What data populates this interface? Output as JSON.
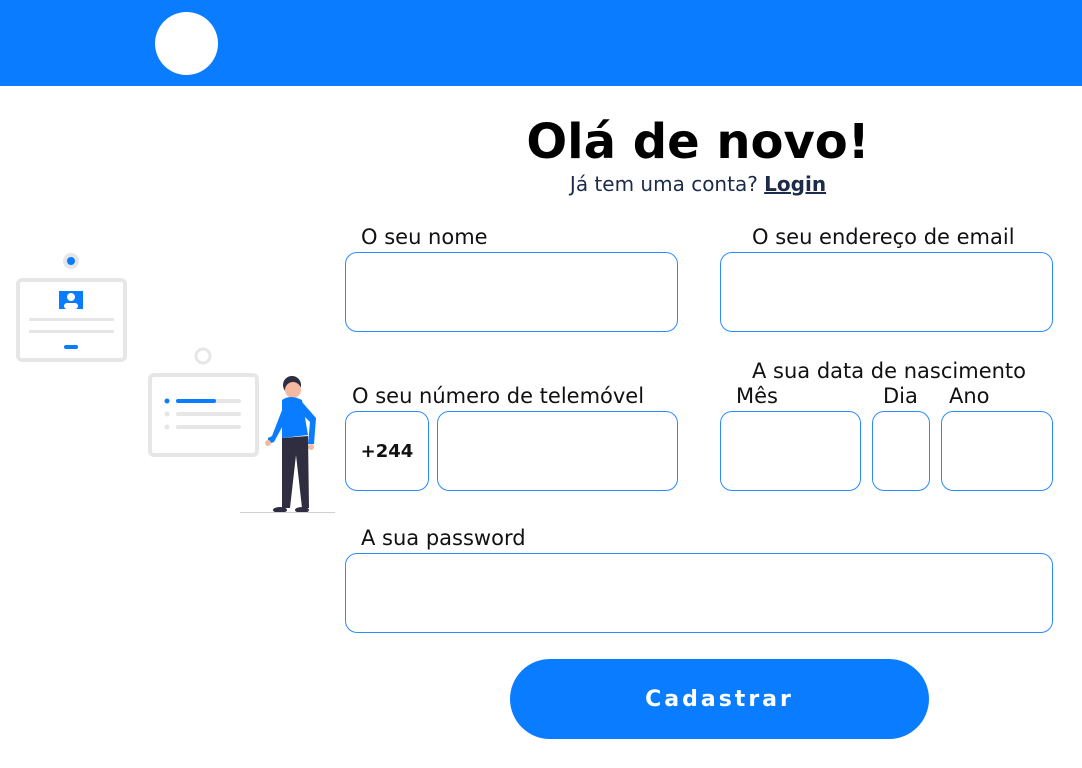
{
  "header": {
    "logo_alt": "logo"
  },
  "heading": {
    "title": "Olá de novo!",
    "subtitle": "Já tem uma conta?",
    "login_link": "Login"
  },
  "form": {
    "name_label": "O seu nome",
    "email_label": "O seu endereço de email",
    "phone_label": "O seu número de telemóvel",
    "phone_prefix": "+244",
    "birthdate_label": "A sua data de nascimento",
    "month_label": "Mês",
    "day_label": "Dia",
    "year_label": "Ano",
    "password_label": "A sua password",
    "submit_label": "Cadastrar"
  },
  "colors": {
    "primary": "#0a7cff",
    "border": "#2b8cff",
    "illustration_gray": "#e6e6e6",
    "person_pants": "#2f2e41"
  }
}
